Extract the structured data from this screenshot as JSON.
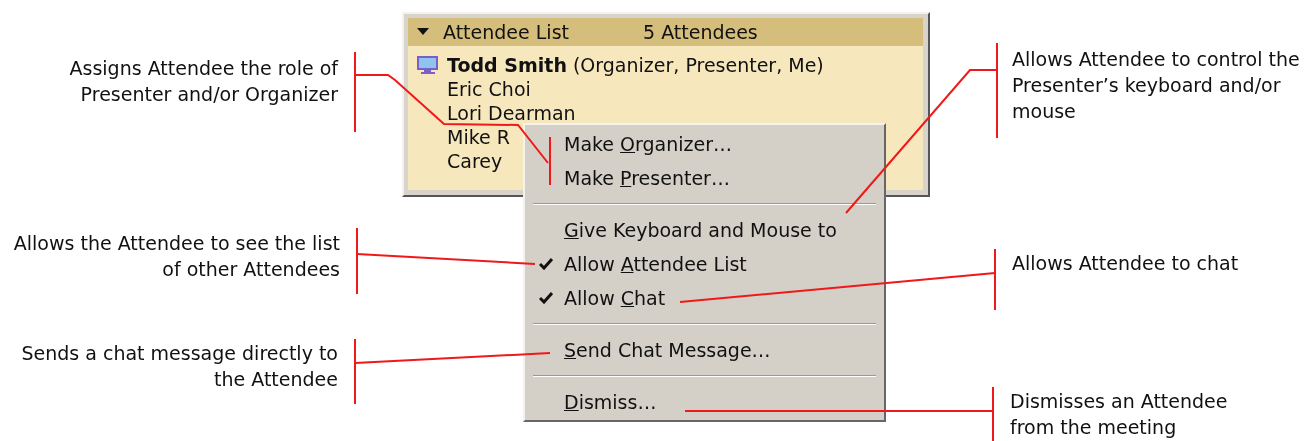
{
  "attendee_panel": {
    "title": "Attendee List",
    "count": "5 Attendees",
    "expanded": true,
    "attendees": [
      {
        "name": "**Todd Smith** (Organizer, Presenter, Me)",
        "kind": "self"
      },
      {
        "name": "Eric Choi",
        "kind": "other"
      },
      {
        "name": "Lori Dearman",
        "kind": "other"
      },
      {
        "name": "Mike R",
        "kind": "other"
      },
      {
        "name": "Carey",
        "kind": "other"
      }
    ]
  },
  "context_menu": {
    "items": [
      {
        "kind": "item",
        "pre": "Make ",
        "key": "O",
        "post": "rganizer…",
        "checked": false
      },
      {
        "kind": "item",
        "pre": "Make ",
        "key": "P",
        "post": "resenter…",
        "checked": false
      },
      {
        "kind": "separator"
      },
      {
        "kind": "item",
        "key": "G",
        "post": "ive Keyboard and Mouse to",
        "checked": false
      },
      {
        "kind": "item",
        "pre": "Allow ",
        "key": "A",
        "post": "ttendee List",
        "checked": true
      },
      {
        "kind": "item",
        "pre": "Allow ",
        "key": "C",
        "post": "hat",
        "checked": true
      },
      {
        "kind": "separator"
      },
      {
        "kind": "item",
        "key": "S",
        "post": "end Chat Message…",
        "checked": false
      },
      {
        "kind": "separator"
      },
      {
        "kind": "item",
        "key": "D",
        "post": "ismiss…",
        "checked": false
      }
    ]
  },
  "left_callouts": [
    "Assigns Attendee the role of Presenter and/or Organizer",
    "Allows the Attendee to see the list of other Attendees",
    "Sends a chat message directly to the Attendee"
  ],
  "right_callouts": [
    "Allows Attendee to control the Presenter’s keyboard and/or mouse",
    "Allows Attendee to chat",
    "Dismisses an Attendee from the meeting"
  ]
}
